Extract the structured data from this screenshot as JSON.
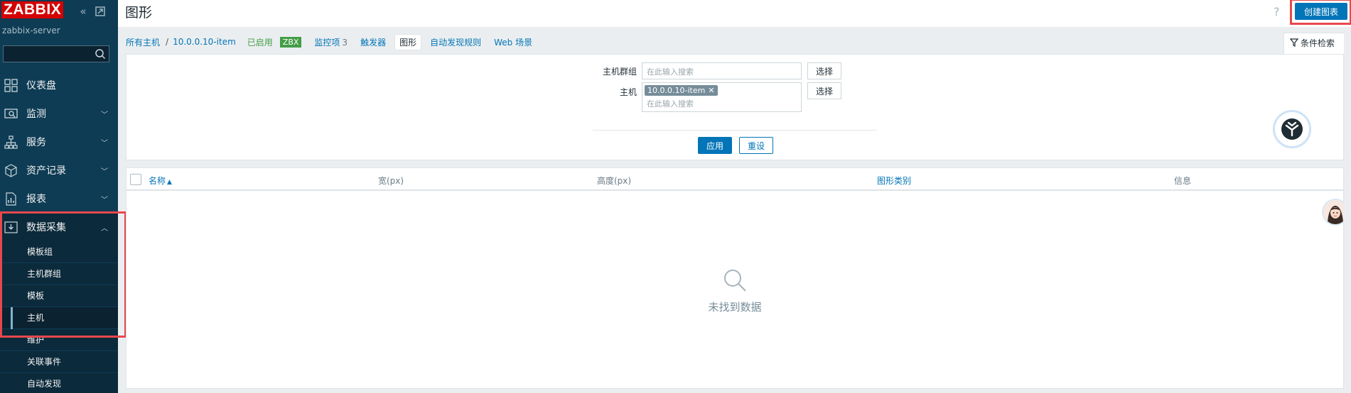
{
  "sidebar": {
    "logo": "ZABBIX",
    "server_name": "zabbix-server",
    "search_placeholder": "",
    "items": [
      {
        "label": "仪表盘",
        "icon": "dashboard-icon",
        "has_arrow": false
      },
      {
        "label": "监测",
        "icon": "monitoring-icon",
        "has_arrow": true
      },
      {
        "label": "服务",
        "icon": "services-icon",
        "has_arrow": true
      },
      {
        "label": "资产记录",
        "icon": "inventory-icon",
        "has_arrow": true
      },
      {
        "label": "报表",
        "icon": "reports-icon",
        "has_arrow": true
      },
      {
        "label": "数据采集",
        "icon": "data-collection-icon",
        "has_arrow": true,
        "open": true
      }
    ],
    "submenu": [
      {
        "label": "模板组"
      },
      {
        "label": "主机群组"
      },
      {
        "label": "模板"
      },
      {
        "label": "主机",
        "active": true
      },
      {
        "label": "维护"
      },
      {
        "label": "关联事件"
      },
      {
        "label": "自动发现"
      }
    ],
    "arrow_down": "⌄",
    "arrow_up": "⌃"
  },
  "header": {
    "title": "图形",
    "help": "?",
    "create_button": "创建图表"
  },
  "nav": {
    "all_hosts": "所有主机",
    "separator": "/",
    "host": "10.0.0.10-item",
    "status": "已启用",
    "zbx": "ZBX",
    "items_label": "监控项",
    "items_count": "3",
    "triggers": "触发器",
    "graphs": "图形",
    "discovery": "自动发现规则",
    "web": "Web 场景",
    "filter_tab": "条件检索"
  },
  "filter": {
    "host_group_label": "主机群组",
    "host_group_placeholder": "在此输入搜索",
    "host_label": "主机",
    "host_tag": "10.0.0.10-item",
    "host_placeholder": "在此输入搜索",
    "select_button": "选择",
    "apply_button": "应用",
    "reset_button": "重设"
  },
  "table": {
    "columns": [
      {
        "label": "名称",
        "sortable": true,
        "sort": "▲"
      },
      {
        "label": "宽(px)",
        "sortable": false
      },
      {
        "label": "高度(px)",
        "sortable": false
      },
      {
        "label": "图形类别",
        "sortable": true
      },
      {
        "label": "信息",
        "sortable": false
      }
    ],
    "rows": [],
    "empty_text": "未找到数据"
  },
  "colors": {
    "sidebar_bg": "#0e3c54",
    "accent": "#0275b8",
    "logo_red": "#d40000",
    "enabled_green": "#429e47",
    "highlight_red": "#e8484c"
  }
}
